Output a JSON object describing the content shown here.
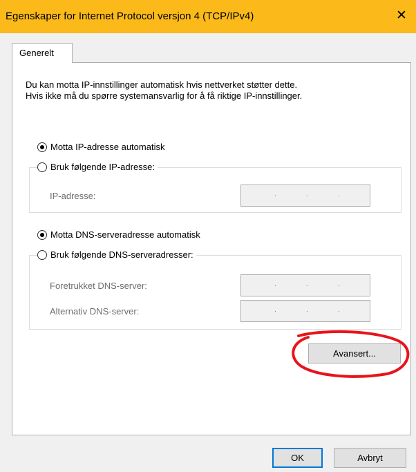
{
  "window": {
    "title": "Egenskaper for Internet Protocol versjon 4 (TCP/IPv4)",
    "close_glyph": "✕",
    "accent_color": "#fbba19"
  },
  "tabs": [
    {
      "label": "Generelt",
      "selected": true
    }
  ],
  "description": {
    "line1": "Du kan motta IP-innstillinger automatisk hvis nettverket støtter dette.",
    "line2": "Hvis ikke må du spørre systemansvarlig for å få riktige IP-innstillinger."
  },
  "ip_section": {
    "auto_label": "Motta IP-adresse automatisk",
    "auto_selected": true,
    "manual_label": "Bruk følgende IP-adresse:",
    "manual_selected": false,
    "ip_label": "IP-adresse:",
    "ip_value": ". . ."
  },
  "dns_section": {
    "auto_label": "Motta DNS-serveradresse automatisk",
    "auto_selected": true,
    "manual_label": "Bruk følgende DNS-serveradresser:",
    "manual_selected": false,
    "preferred_label": "Foretrukket DNS-server:",
    "alternate_label": "Alternativ DNS-server:"
  },
  "buttons": {
    "advanced": "Avansert...",
    "ok": "OK",
    "cancel": "Avbryt"
  },
  "annotation": {
    "stroke_color": "#e8141b",
    "icon": "red-hand-drawn-circle"
  }
}
